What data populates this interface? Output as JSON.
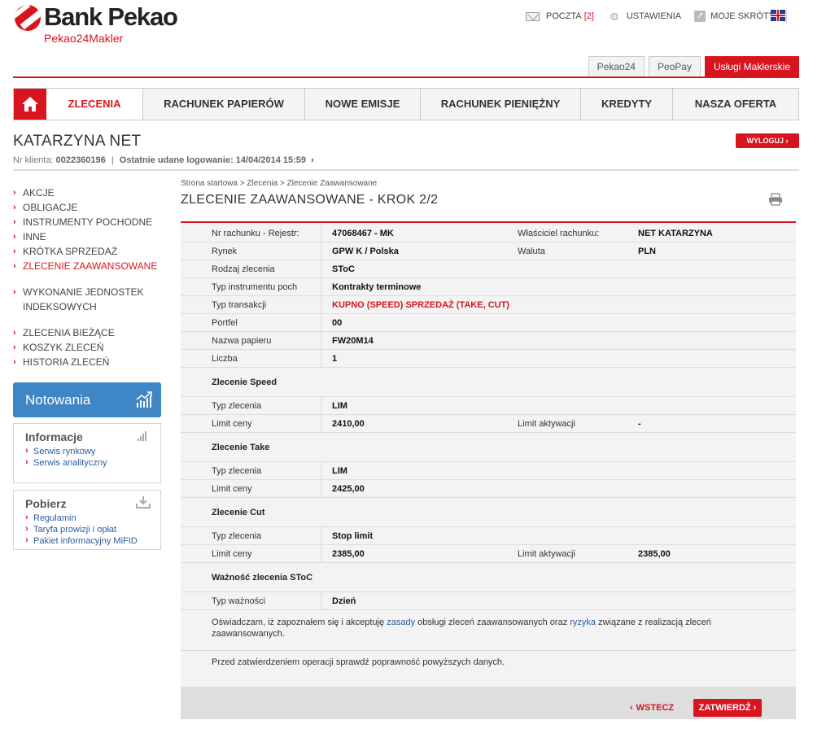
{
  "brand": {
    "name": "Bank Pekao",
    "sub": "Pekao24Makler"
  },
  "toplinks": {
    "mail_label": "POCZTA",
    "mail_count": "[2]",
    "settings_label": "USTAWIENIA",
    "shortcuts_label": "MOJE SKRÓTY"
  },
  "sitetabs": [
    "Pekao24",
    "PeoPay",
    "Usługi Maklerskie"
  ],
  "nav": [
    "ZLECENIA",
    "RACHUNEK PAPIERÓW",
    "NOWE EMISJE",
    "RACHUNEK PIENIĘŻNY",
    "KREDYTY",
    "NASZA OFERTA"
  ],
  "user": {
    "name": "KATARZYNA NET",
    "client_label": "Nr klienta:",
    "client_no": "0022360196",
    "sep": "|",
    "last_login_label": "Ostatnie udane logowanie:",
    "last_login": "14/04/2014 15:59",
    "logout": "WYLOGUJ"
  },
  "leftmenu": {
    "group1": [
      "AKCJE",
      "OBLIGACJE",
      "INSTRUMENTY POCHODNE",
      "INNE",
      "KRÓTKA SPRZEDAŻ",
      "ZLECENIE ZAAWANSOWANE"
    ],
    "group2": [
      "WYKONANIE JEDNOSTEK INDEKSOWYCH"
    ],
    "group3": [
      "ZLECENIA BIEŻĄCE",
      "KOSZYK ZLECEŃ",
      "HISTORIA ZLECEŃ"
    ]
  },
  "notowania": "Notowania",
  "info": {
    "title": "Informacje",
    "links": [
      "Serwis rynkowy",
      "Serwis analityczny"
    ]
  },
  "pobierz": {
    "title": "Pobierz",
    "links": [
      "Regulamin",
      "Taryfa prowizji i opłat",
      "Pakiet informacyjny MiFID"
    ]
  },
  "breadcrumb": "Strona startowa > Zlecenia > Zlecenie Zaawansowane",
  "title": "ZLECENIE ZAAWANSOWANE - KROK 2/2",
  "rows": {
    "r1": {
      "l": "Nr rachunku - Rejestr:",
      "v": "47068467 - MK",
      "l2": "Właściciel rachunku:",
      "v2": "NET KATARZYNA"
    },
    "r2": {
      "l": "Rynek",
      "v": "GPW K / Polska",
      "l2": "Waluta",
      "v2": "PLN"
    },
    "r3": {
      "l": "Rodzaj zlecenia",
      "v": "SToC"
    },
    "r4": {
      "l": "Typ instrumentu poch",
      "v": "Kontrakty terminowe"
    },
    "r5": {
      "l": "Typ transakcji",
      "v": "KUPNO (SPEED) SPRZEDAŻ (TAKE, CUT)"
    },
    "r6": {
      "l": "Portfel",
      "v": "00"
    },
    "r7": {
      "l": "Nazwa papieru",
      "v": "FW20M14"
    },
    "r8": {
      "l": "Liczba",
      "v": "1"
    },
    "s1": "Zlecenie Speed",
    "r9": {
      "l": "Typ zlecenia",
      "v": "LIM"
    },
    "r10": {
      "l": "Limit ceny",
      "v": "2410,00",
      "l2": "Limit aktywacji",
      "v2": "-"
    },
    "s2": "Zlecenie Take",
    "r11": {
      "l": "Typ zlecenia",
      "v": "LIM"
    },
    "r12": {
      "l": "Limit ceny",
      "v": "2425,00"
    },
    "s3": "Zlecenie Cut",
    "r13": {
      "l": "Typ zlecenia",
      "v": "Stop limit"
    },
    "r14": {
      "l": "Limit ceny",
      "v": "2385,00",
      "l2": "Limit aktywacji",
      "v2": "2385,00"
    },
    "s4": "Ważność zlecenia SToC",
    "r15": {
      "l": "Typ ważności",
      "v": "Dzień"
    }
  },
  "declaration": {
    "p1": "Oświadczam, iż zapoznałem się i akceptuję",
    "link1": "zasady",
    "p2": "obsługi zleceń zaawansowanych oraz",
    "link2": "ryzyka",
    "p3": "związane z realizacją zleceń zaawansowanych."
  },
  "check_text": "Przed zatwierdzeniem operacji sprawdź poprawność powyższych danych.",
  "buttons": {
    "back": "WSTECZ",
    "confirm": "ZATWIERDŹ"
  }
}
